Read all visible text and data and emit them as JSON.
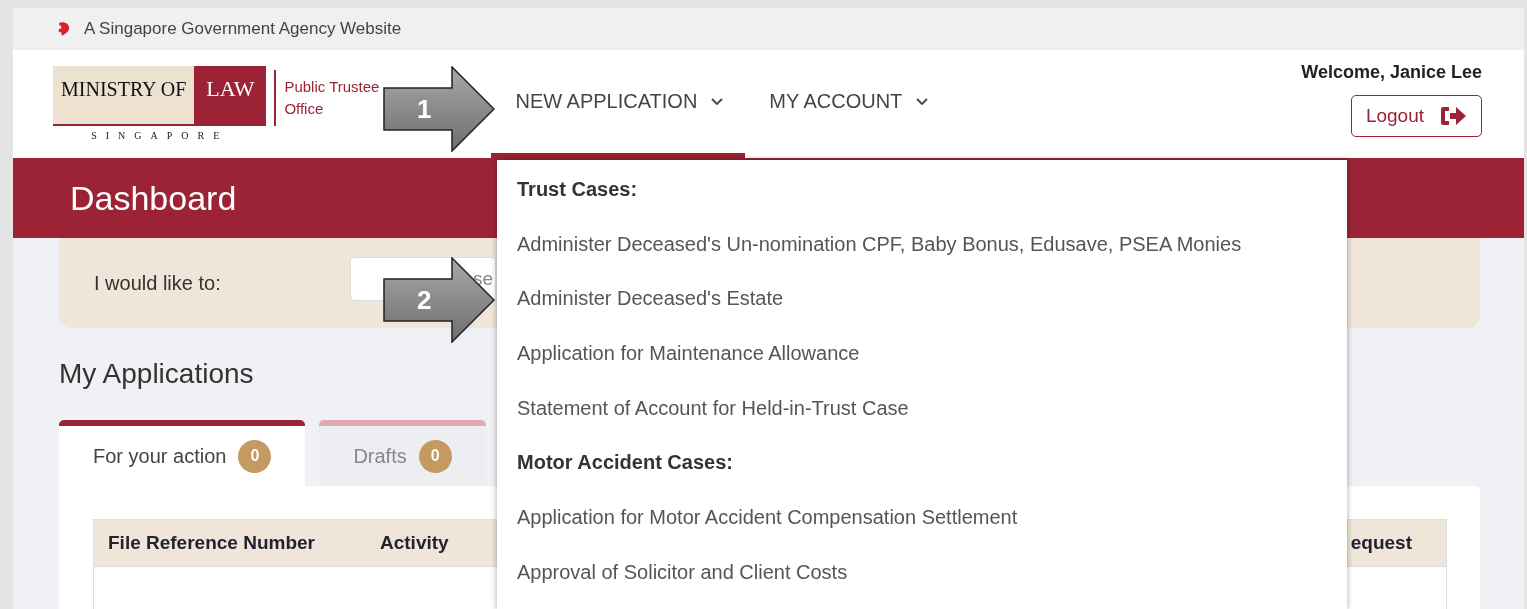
{
  "gov_banner": {
    "text": "A Singapore Government Agency Website"
  },
  "logo": {
    "ministry": "MINISTRY OF",
    "law": "LAW",
    "country": "SINGAPORE",
    "office_line_1": "Public Trustee",
    "office_line_2": "Office"
  },
  "nav": [
    {
      "label": "NEW APPLICATION",
      "selected": true
    },
    {
      "label": "MY ACCOUNT",
      "selected": false
    }
  ],
  "user": {
    "welcome": "Welcome, Janice Lee",
    "logout": "Logout"
  },
  "page_title": "Dashboard",
  "filter": {
    "label": "I would like to:",
    "placeholder": "se"
  },
  "section_title": "My Applications",
  "tabs": [
    {
      "label": "For your action",
      "count": "0",
      "selected": true
    },
    {
      "label": "Drafts",
      "count": "0",
      "selected": false
    }
  ],
  "table": {
    "columns": [
      "File Reference Number",
      "Activity",
      "equest"
    ]
  },
  "dropdown": [
    {
      "kind": "heading",
      "text": "Trust Cases:"
    },
    {
      "kind": "item",
      "text": "Administer Deceased's Un-nomination CPF, Baby Bonus, Edusave, PSEA Monies"
    },
    {
      "kind": "item",
      "text": "Administer Deceased's Estate"
    },
    {
      "kind": "item",
      "text": "Application for Maintenance Allowance"
    },
    {
      "kind": "item",
      "text": "Statement of Account for Held-in-Trust Case"
    },
    {
      "kind": "heading",
      "text": "Motor Accident Cases:"
    },
    {
      "kind": "item",
      "text": "Application for Motor Accident Compensation Settlement"
    },
    {
      "kind": "item",
      "text": "Approval of Solicitor and Client Costs"
    }
  ],
  "callouts": [
    "1",
    "2"
  ]
}
